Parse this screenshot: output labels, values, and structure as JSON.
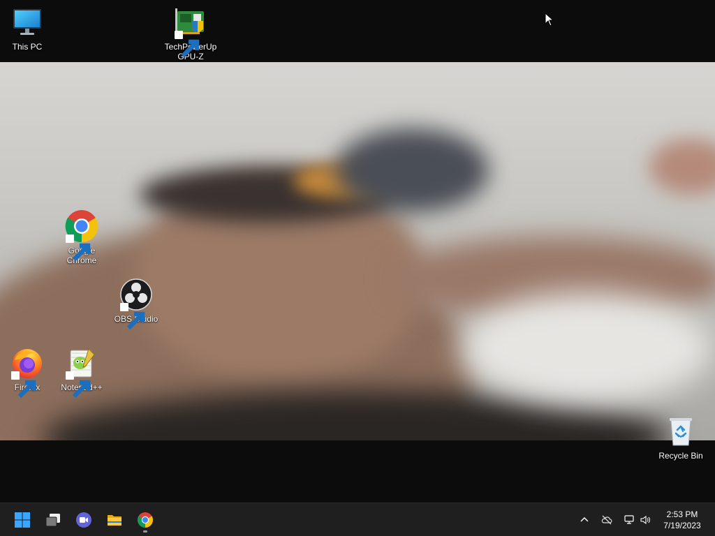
{
  "desktop": {
    "icons": [
      {
        "name": "This PC",
        "label": "This PC"
      },
      {
        "name": "TechPowerUp GPU-Z",
        "label": "TechPowerUp\nGPU-Z"
      },
      {
        "name": "Google Chrome",
        "label": "Google\nChrome"
      },
      {
        "name": "OBS Studio",
        "label": "OBS Studio"
      },
      {
        "name": "Firefox",
        "label": "Firefox"
      },
      {
        "name": "Notepad++",
        "label": "Notepad++"
      },
      {
        "name": "Recycle Bin",
        "label": "Recycle Bin"
      }
    ]
  },
  "taskbar": {
    "pinned": [
      {
        "icon": "windows-start-icon"
      },
      {
        "icon": "task-view-icon"
      },
      {
        "icon": "chat-icon"
      },
      {
        "icon": "file-explorer-icon"
      },
      {
        "icon": "chrome-icon"
      }
    ],
    "tray": {
      "icons": [
        "chevron-up-icon",
        "onedrive-offline-icon",
        "network-icon",
        "volume-icon"
      ]
    },
    "clock": {
      "time": "2:53 PM",
      "date": "7/19/2023"
    }
  },
  "colors": {
    "taskbar_bg": "#1f1f1f",
    "desktop_bg": "#0c0c0d",
    "label_text": "#ffffff"
  }
}
